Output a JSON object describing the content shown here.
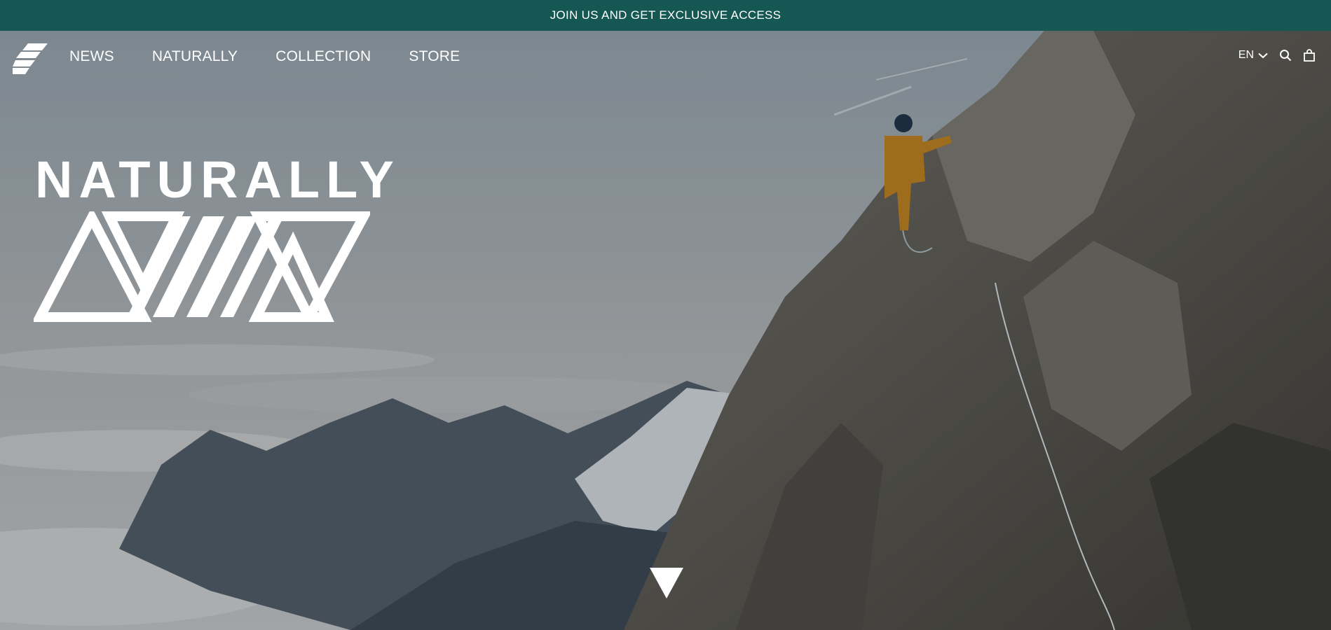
{
  "announcement": {
    "text": "JOIN US AND GET EXCLUSIVE ACCESS"
  },
  "nav": {
    "logo_icon": "brand-stripes-logo",
    "links": [
      "NEWS",
      "NATURALLY",
      "COLLECTION",
      "STORE"
    ],
    "language": "EN",
    "icons": [
      "chevron-down-icon",
      "search-icon",
      "shopping-bag-icon"
    ]
  },
  "hero": {
    "headline": "NATURALLY",
    "logo_icon": "triangle-pattern-logo",
    "scroll_icon": "down-triangle-arrow",
    "image": "mountaineer-on-rocky-ridge-above-clouds"
  },
  "colors": {
    "announcement_bg": "#155753",
    "text": "#ffffff"
  }
}
